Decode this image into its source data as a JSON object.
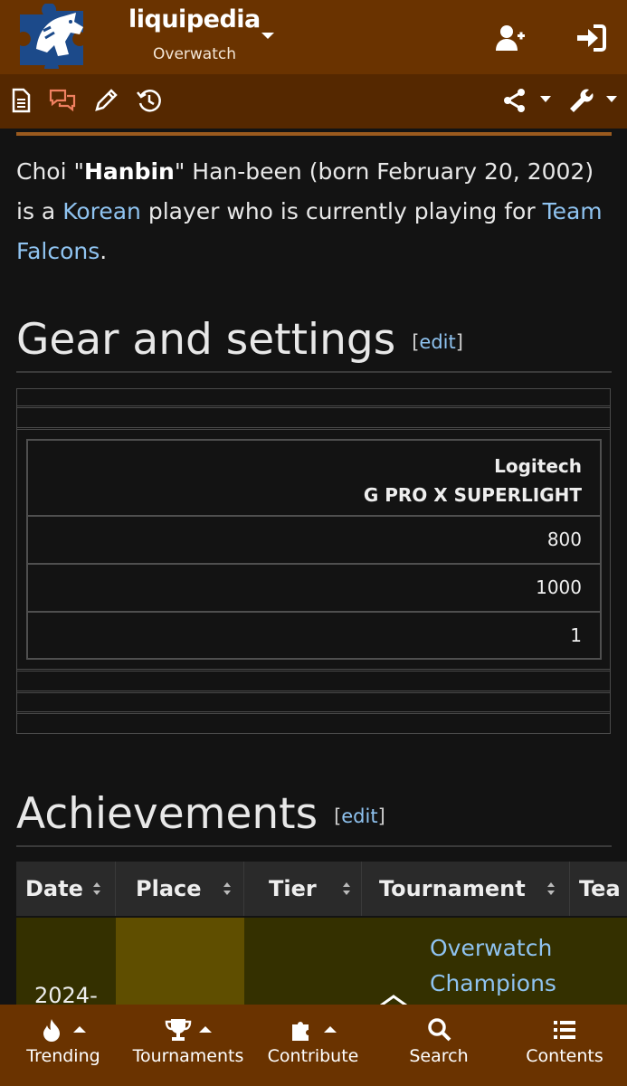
{
  "header": {
    "brand": "liquipedia",
    "wiki": "Overwatch",
    "icons": [
      "liquipedia-logo-icon",
      "add-user-icon",
      "sign-in-icon"
    ]
  },
  "toolbar": {
    "icons": [
      "page-icon",
      "discussion-icon",
      "edit-pencil-icon",
      "history-icon",
      "share-icon",
      "wrench-icon"
    ]
  },
  "intro": {
    "part1": "Choi \"",
    "nickname": "Hanbin",
    "part2": "\" Han-been (born February 20, 2002) is a ",
    "link_nationality": "Korean",
    "part3": " player who is currently playing for ",
    "link_team": "Team Falcons",
    "part4": "."
  },
  "gear_section": {
    "heading": "Gear and settings",
    "edit_open": "[",
    "edit_label": "edit",
    "edit_close": "]",
    "mouse_brand": "Logitech",
    "mouse_model": "G PRO X SUPERLIGHT",
    "values": [
      "800",
      "1000",
      "1"
    ]
  },
  "achievements_section": {
    "heading": "Achievements",
    "edit_open": "[",
    "edit_label": "edit",
    "edit_close": "]",
    "columns": [
      "Date",
      "Place",
      "Tier",
      "Tournament",
      "Tea"
    ],
    "first_row": {
      "date": "2024-",
      "tournament_line1": "Overwatch",
      "tournament_line2": "Champions"
    }
  },
  "bottom_nav": {
    "items": [
      {
        "label": "Trending",
        "icon": "fire-icon"
      },
      {
        "label": "Tournaments",
        "icon": "trophy-icon"
      },
      {
        "label": "Contribute",
        "icon": "puzzle-icon"
      },
      {
        "label": "Search",
        "icon": "search-icon"
      },
      {
        "label": "Contents",
        "icon": "list-icon"
      }
    ]
  },
  "colors": {
    "header_bg": "#6a3300",
    "toolbar_bg": "#552800",
    "page_bg": "#131313",
    "link": "#8fc3f0",
    "row_olive": "#343000",
    "place_gold": "#5f4e00"
  }
}
